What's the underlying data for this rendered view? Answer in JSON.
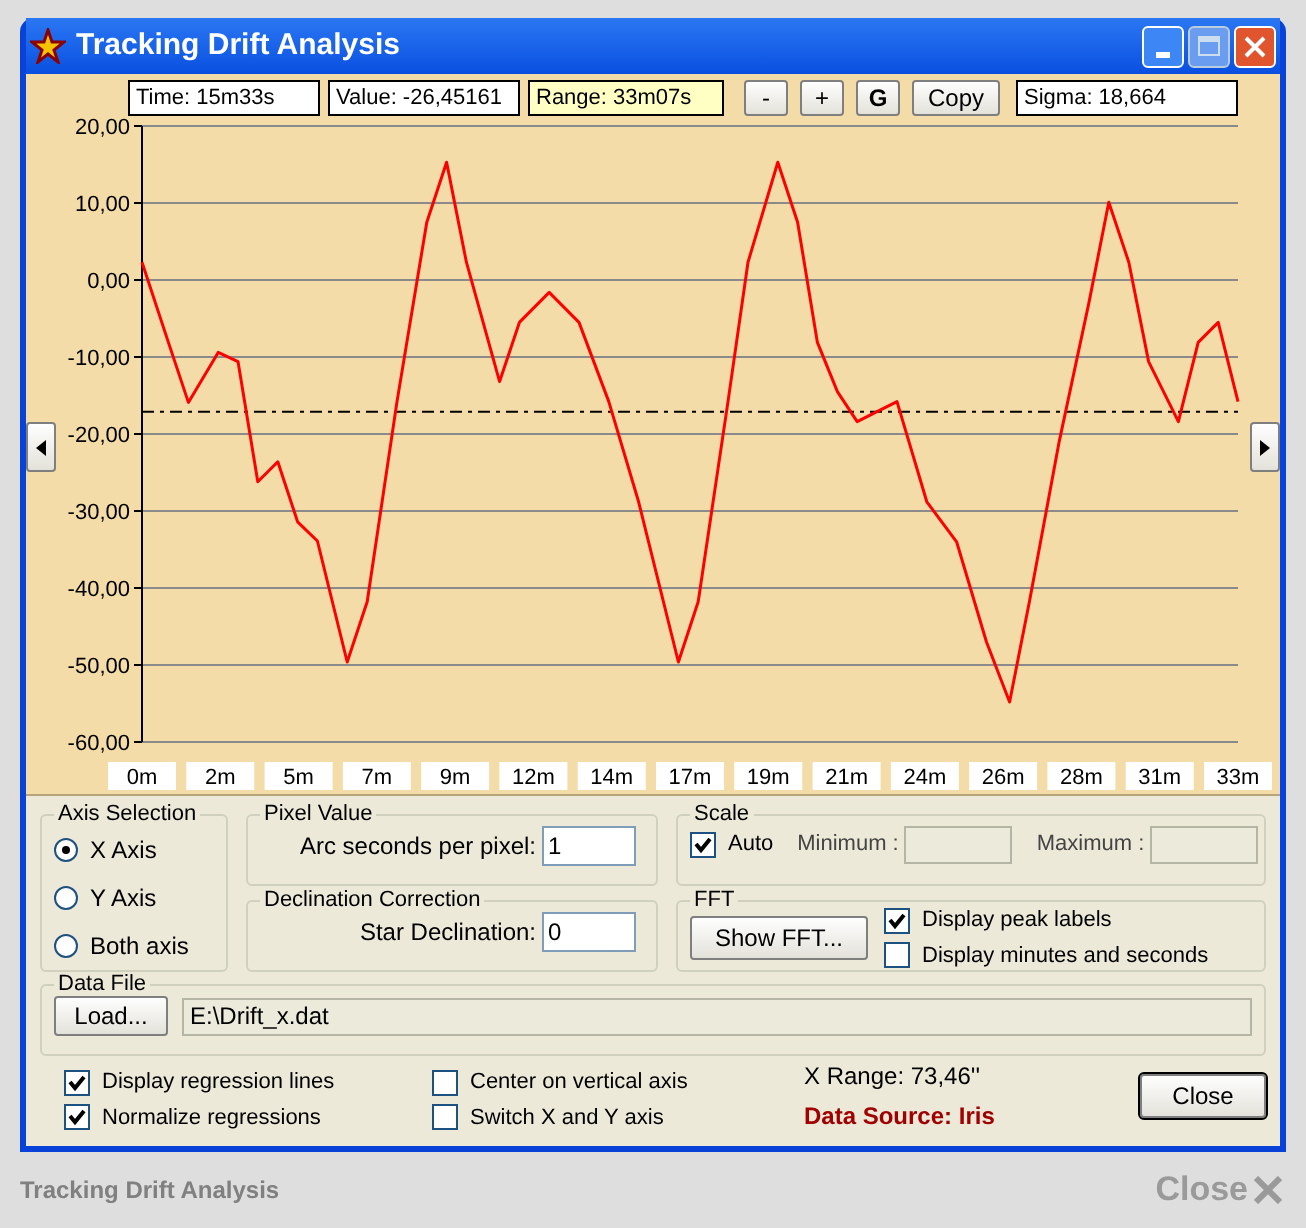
{
  "window": {
    "title": "Tracking Drift Analysis"
  },
  "toolbar": {
    "fields": [
      {
        "text": "Time: 15m33s",
        "highlight": false
      },
      {
        "text": "Value: -26,45161",
        "highlight": false
      },
      {
        "text": "Range: 33m07s",
        "highlight": true
      }
    ],
    "buttons": [
      {
        "label": "-",
        "bold": false
      },
      {
        "label": "+",
        "bold": false
      },
      {
        "label": "G",
        "bold": true
      },
      {
        "label": "Copy",
        "bold": false
      }
    ],
    "sigma": "Sigma: 18,664"
  },
  "chart_data": {
    "type": "line",
    "x": [
      0,
      0.8,
      1.4,
      2.3,
      2.9,
      3.5,
      4.1,
      4.7,
      5.3,
      6.2,
      6.8,
      7.7,
      8.6,
      9.2,
      9.8,
      10.8,
      11.4,
      12.3,
      13.2,
      14.1,
      15.0,
      16.2,
      16.8,
      17.7,
      18.3,
      19.2,
      19.8,
      20.4,
      21.0,
      21.6,
      22.2,
      22.8,
      23.7,
      24.6,
      25.5,
      26.2,
      26.8,
      27.7,
      28.6,
      29.2,
      29.8,
      30.4,
      31.3,
      31.9,
      32.5,
      33.1
    ],
    "grid": true,
    "series": [
      {
        "color": "#ff0000",
        "values": [
          2.3,
          -8.1,
          -15.9,
          -9.4,
          -10.6,
          -26.2,
          -23.6,
          -31.4,
          -33.9,
          -49.6,
          -41.8,
          -15.8,
          7.5,
          15.3,
          2.3,
          -13.2,
          -5.5,
          -1.6,
          -5.5,
          -15.8,
          -28.8,
          -49.6,
          -41.8,
          -15.8,
          2.3,
          15.3,
          7.5,
          -8.1,
          -14.5,
          -18.4,
          -17.1,
          -15.8,
          -28.8,
          -34.0,
          -47.0,
          -54.8,
          -41.8,
          -21.0,
          -2.9,
          10.1,
          2.3,
          -10.6,
          -18.4,
          -8.1,
          -5.5,
          -15.8
        ]
      }
    ],
    "xlim": [
      0,
      33.1
    ],
    "ylim": [
      -60,
      20
    ],
    "xticks": [
      {
        "value": 0,
        "label": "0m"
      },
      {
        "value": 2.364,
        "label": "2m"
      },
      {
        "value": 4.729,
        "label": "5m"
      },
      {
        "value": 7.093,
        "label": "7m"
      },
      {
        "value": 9.457,
        "label": "9m"
      },
      {
        "value": 11.821,
        "label": "12m"
      },
      {
        "value": 14.186,
        "label": "14m"
      },
      {
        "value": 16.55,
        "label": "17m"
      },
      {
        "value": 18.914,
        "label": "19m"
      },
      {
        "value": 21.279,
        "label": "21m"
      },
      {
        "value": 23.643,
        "label": "24m"
      },
      {
        "value": 26.007,
        "label": "26m"
      },
      {
        "value": 28.371,
        "label": "28m"
      },
      {
        "value": 30.736,
        "label": "31m"
      },
      {
        "value": 33.1,
        "label": "33m"
      }
    ],
    "yticks": [
      {
        "value": 20,
        "label": "20,00"
      },
      {
        "value": 10,
        "label": "10,00"
      },
      {
        "value": 0,
        "label": "0,00"
      },
      {
        "value": -10,
        "label": "-10,00"
      },
      {
        "value": -20,
        "label": "-20,00"
      },
      {
        "value": -30,
        "label": "-30,00"
      },
      {
        "value": -40,
        "label": "-40,00"
      },
      {
        "value": -50,
        "label": "-50,00"
      },
      {
        "value": -60,
        "label": "-60,00"
      }
    ],
    "ref_lines": [
      {
        "axis": "y",
        "value": -17.1
      }
    ]
  },
  "axis_selection": {
    "title": "Axis Selection",
    "options": [
      {
        "label": "X Axis",
        "selected": true
      },
      {
        "label": "Y Axis",
        "selected": false
      },
      {
        "label": "Both axis",
        "selected": false
      }
    ]
  },
  "pixel_value": {
    "title": "Pixel Value",
    "label": "Arc seconds per pixel:",
    "value": "1"
  },
  "declination": {
    "title": "Declination Correction",
    "label": "Star Declination:",
    "value": "0"
  },
  "scale": {
    "title": "Scale",
    "auto": {
      "label": "Auto",
      "checked": true
    },
    "minimum": {
      "label": "Minimum :",
      "disabled": true
    },
    "maximum": {
      "label": "Maximum :",
      "disabled": true
    }
  },
  "fft": {
    "title": "FFT",
    "button": "Show FFT...",
    "options": [
      {
        "label": "Display peak labels",
        "checked": true
      },
      {
        "label": "Display minutes and seconds",
        "checked": false
      }
    ]
  },
  "data_file": {
    "title": "Data File",
    "button": "Load...",
    "path": "E:\\Drift_x.dat"
  },
  "options": [
    {
      "label": "Display regression lines",
      "checked": true
    },
    {
      "label": "Normalize regressions",
      "checked": true
    },
    {
      "label": "Center on vertical axis",
      "checked": false
    },
    {
      "label": "Switch X and Y axis",
      "checked": false
    }
  ],
  "x_range": "X Range: 73,46''",
  "data_source": "Data Source: Iris",
  "close_button": "Close",
  "footer": {
    "caption": "Tracking Drift Analysis",
    "close": "Close"
  }
}
